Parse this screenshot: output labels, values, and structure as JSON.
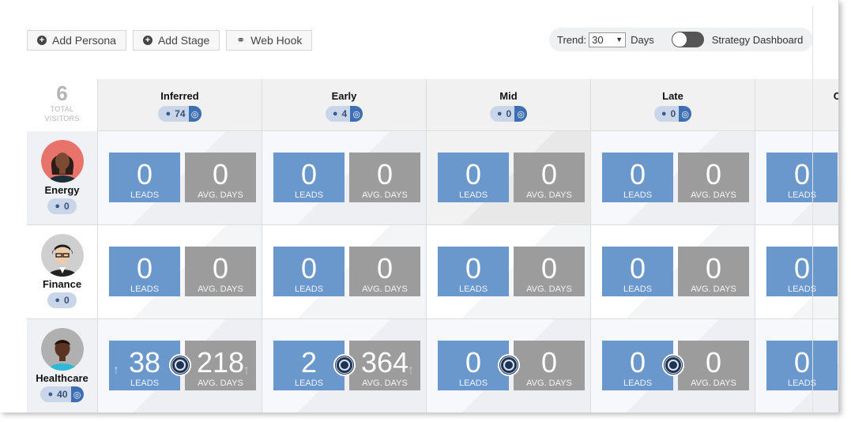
{
  "toolbar": {
    "add_persona": "Add Persona",
    "add_stage": "Add Stage",
    "web_hook": "Web Hook"
  },
  "trend": {
    "label": "Trend:",
    "value": "30",
    "unit": "Days",
    "toggle_label": "Strategy Dashboard",
    "toggle_on": false
  },
  "summary": {
    "total": "6",
    "total_label_1": "TOTAL",
    "total_label_2": "VISITORS"
  },
  "stages": [
    {
      "name": "Inferred",
      "count": "74"
    },
    {
      "name": "Early",
      "count": "4"
    },
    {
      "name": "Mid",
      "count": "0"
    },
    {
      "name": "Late",
      "count": "0"
    },
    {
      "name": "C",
      "count": ""
    }
  ],
  "labels": {
    "leads": "LEADS",
    "avg_days": "AVG. DAYS"
  },
  "personas": [
    {
      "name": "Energy",
      "count": "0",
      "cells": [
        {
          "leads": "0",
          "days": "0"
        },
        {
          "leads": "0",
          "days": "0"
        },
        {
          "leads": "0",
          "days": "0"
        },
        {
          "leads": "0",
          "days": "0"
        },
        {
          "leads": "0",
          "days": ""
        }
      ]
    },
    {
      "name": "Finance",
      "count": "0",
      "cells": [
        {
          "leads": "0",
          "days": "0"
        },
        {
          "leads": "0",
          "days": "0"
        },
        {
          "leads": "0",
          "days": "0"
        },
        {
          "leads": "0",
          "days": "0"
        },
        {
          "leads": "0",
          "days": ""
        }
      ]
    },
    {
      "name": "Healthcare",
      "count": "40",
      "cells": [
        {
          "leads": "38",
          "days": "218"
        },
        {
          "leads": "2",
          "days": "364"
        },
        {
          "leads": "0",
          "days": "0"
        },
        {
          "leads": "0",
          "days": "0"
        },
        {
          "leads": "0",
          "days": ""
        }
      ]
    }
  ],
  "colors": {
    "leads_box": "#6a98cc",
    "days_box": "#9c9c9c",
    "pill_bg": "#c9d6ea",
    "pill_accent": "#3f6fb3",
    "ring": "#1f3453"
  },
  "icons": {
    "add": "plus-circle-icon",
    "link": "link-icon",
    "person": "person-icon",
    "target": "target-icon"
  }
}
